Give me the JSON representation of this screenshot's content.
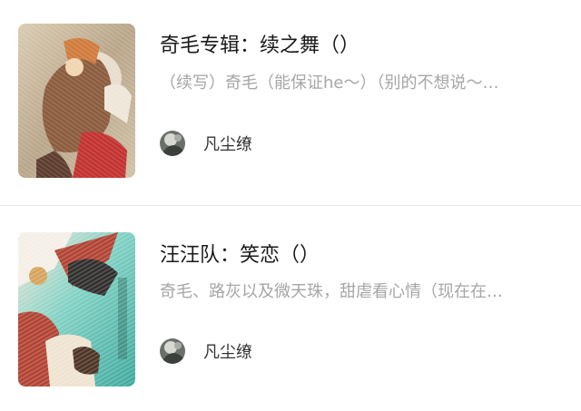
{
  "posts": [
    {
      "title": "奇毛专辑：续之舞（）",
      "summary": "（续写）奇毛（能保证he～）（别的不想说～…",
      "author": "凡尘缭",
      "cover_icon": "anime-illustration-warm",
      "colors": {
        "cover_main": "#8a5a3c",
        "cover_accent": "#c2302e"
      }
    },
    {
      "title": "汪汪队：笑恋（）",
      "summary": "奇毛、路灰以及微天珠，甜虐看心情（现在在…",
      "author": "凡尘缭",
      "cover_icon": "anime-illustration-teal",
      "colors": {
        "cover_main": "#4fb7a9",
        "cover_accent": "#b0402f"
      }
    }
  ],
  "theme": {
    "title_color": "#1a1a1a",
    "summary_color": "#a6a6a6",
    "author_color": "#333333",
    "divider_color": "#e6e6e6"
  }
}
